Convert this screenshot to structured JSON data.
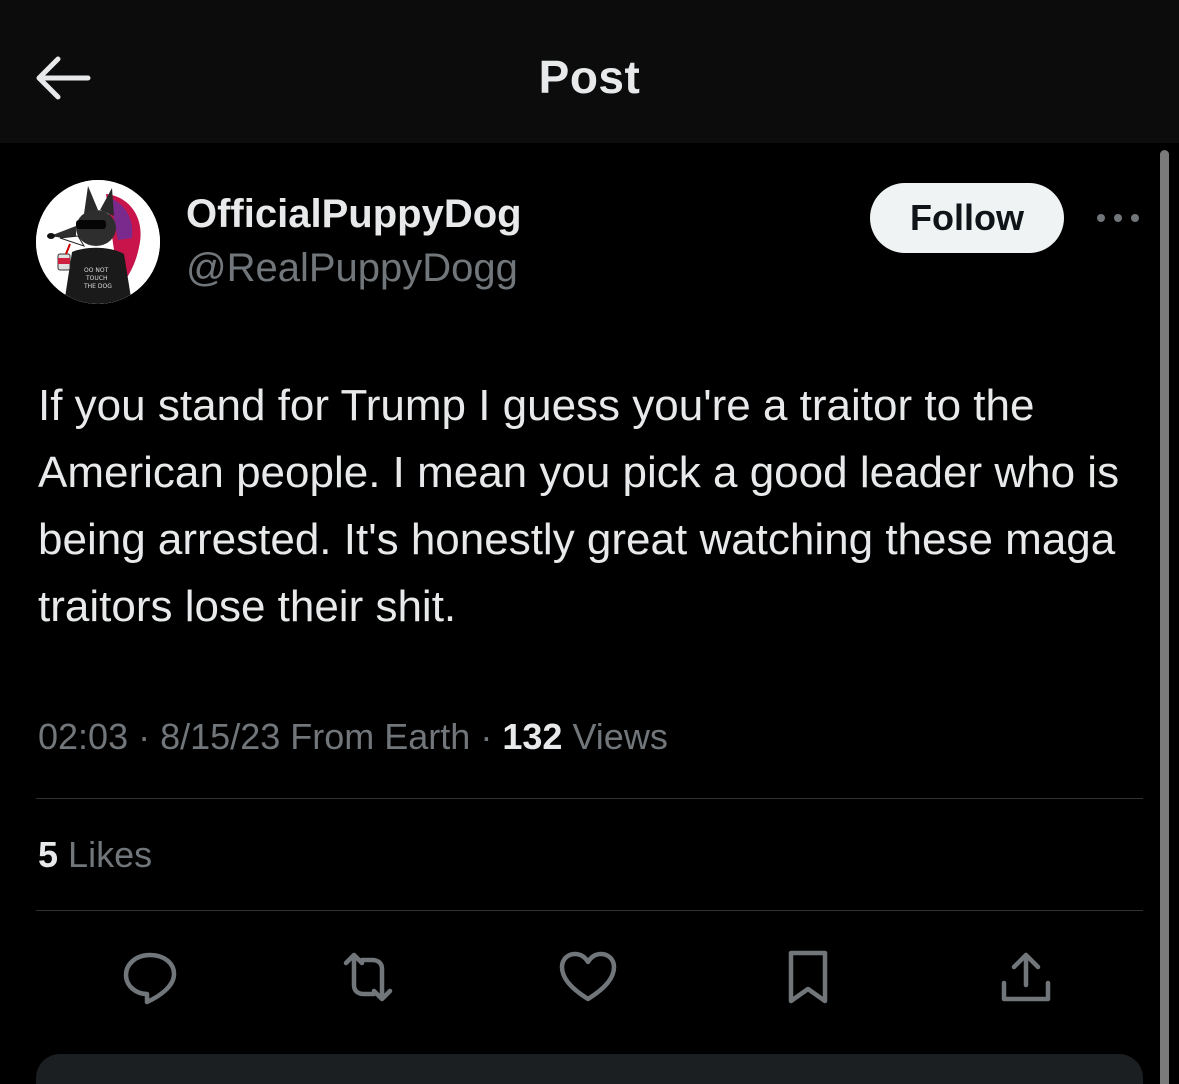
{
  "header": {
    "title": "Post",
    "back_icon": "arrow-left-icon"
  },
  "author": {
    "display_name": "OfficialPuppyDog",
    "handle": "@RealPuppyDogg",
    "follow_label": "Follow",
    "more_icon": "more-horizontal-icon"
  },
  "post": {
    "text": "If you stand for Trump I guess you're a traitor to the American people. I mean you pick a good leader who is being arrested. It's honestly great watching these maga traitors lose their shit.",
    "time": "02:03",
    "date": "8/15/23",
    "location": "From Earth",
    "views_count": "132",
    "views_label": "Views",
    "likes_count": "5",
    "likes_label": "Likes",
    "separator": "·"
  },
  "actions": [
    {
      "name": "reply",
      "icon": "comment-icon"
    },
    {
      "name": "repost",
      "icon": "repost-icon"
    },
    {
      "name": "like",
      "icon": "heart-icon"
    },
    {
      "name": "bookmark",
      "icon": "bookmark-icon"
    },
    {
      "name": "share",
      "icon": "share-icon"
    }
  ],
  "colors": {
    "background": "#000000",
    "header_bg": "#0c0c0c",
    "text_primary": "#e7e9ea",
    "text_secondary": "#71767b",
    "follow_bg": "#eff3f4",
    "divider": "#2f3336"
  }
}
